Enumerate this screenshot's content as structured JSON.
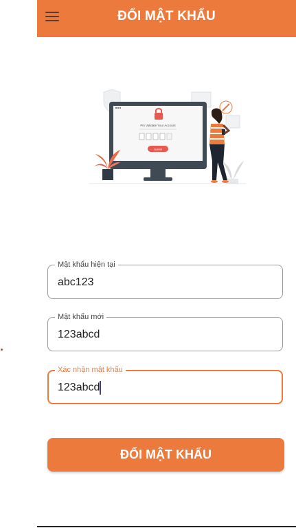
{
  "header": {
    "title": "ĐỔI MẬT KHẨU",
    "menu_icon": "hamburger-menu-icon"
  },
  "illustration": {
    "screen_title": "Pin Validate Your Account",
    "screen_button": "Submit"
  },
  "form": {
    "current_password": {
      "label": "Mật khẩu hiện tại",
      "value": "abc123"
    },
    "new_password": {
      "label": "Mật khẩu mới",
      "value": "123abcd"
    },
    "confirm_password": {
      "label": "Xác nhận mật khẩu",
      "value": "123abcd"
    },
    "submit_label": "ĐỔI MẬT KHẨU"
  },
  "colors": {
    "accent": "#ec7a3c",
    "header_text": "#ffffff",
    "field_border": "#9a9a9a",
    "monitor_frame": "#3f4a55"
  }
}
